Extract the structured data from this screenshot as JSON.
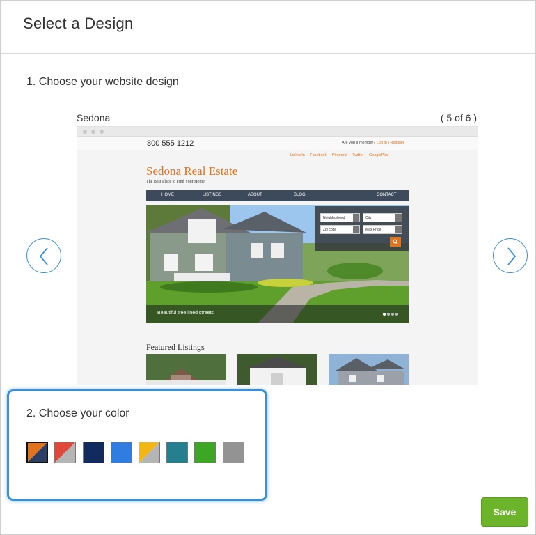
{
  "header": {
    "title": "Select a Design"
  },
  "step1": {
    "label": "1. Choose your website design"
  },
  "design": {
    "name": "Sedona",
    "counter": "( 5 of 6 )"
  },
  "nav": {
    "prev_icon": "chevron-left-icon",
    "next_icon": "chevron-right-icon"
  },
  "preview": {
    "phone": "800 555 1212",
    "member_text": "Are you a member?",
    "login": "Log in",
    "separator": "|",
    "register": "Register",
    "social": [
      "LinkedIn",
      "Facebook",
      "Pinterest",
      "Twitter",
      "GooglePlus"
    ],
    "site_title": "Sedona Real Estate",
    "tagline": "The Best Place to Find Your Home",
    "nav_items": [
      "HOME",
      "LISTINGS",
      "ABOUT",
      "BLOG",
      "CONTACT"
    ],
    "search": {
      "neighborhood": "Neighborhood",
      "city": "City",
      "zip": "Zip code",
      "max_price": "Max Price"
    },
    "hero_caption": "Beautiful tree lined streets",
    "featured_title": "Featured Listings"
  },
  "step2": {
    "label": "2. Choose your color"
  },
  "swatches": [
    {
      "name": "orange-navy",
      "colors": [
        "#e0741c",
        "#2b3f66"
      ],
      "selected": true
    },
    {
      "name": "red-gray",
      "colors": [
        "#e0493a",
        "#b5b5b5"
      ],
      "selected": false
    },
    {
      "name": "navy",
      "colors": [
        "#122b5e"
      ],
      "selected": false
    },
    {
      "name": "blue",
      "colors": [
        "#2f7de1"
      ],
      "selected": false
    },
    {
      "name": "yellow-gray",
      "colors": [
        "#f2b712",
        "#b5b5b5"
      ],
      "selected": false
    },
    {
      "name": "teal",
      "colors": [
        "#257f8f"
      ],
      "selected": false
    },
    {
      "name": "green",
      "colors": [
        "#3ea625"
      ],
      "selected": false
    },
    {
      "name": "gray",
      "colors": [
        "#939393"
      ],
      "selected": false
    }
  ],
  "footer": {
    "save_label": "Save"
  },
  "colors": {
    "accent": "#3a8fd9",
    "save": "#6cb52a",
    "brand_orange": "#e0741c"
  }
}
